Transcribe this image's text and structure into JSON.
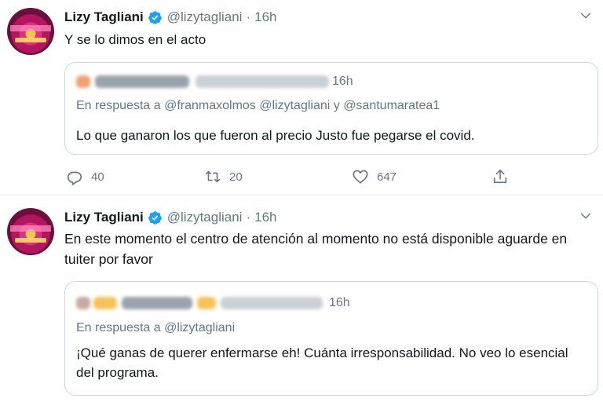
{
  "tweets": [
    {
      "author_name": "Lizy Tagliani",
      "handle": "@lizytagliani",
      "separator": "·",
      "time": "16h",
      "text": "Y se lo dimos en el acto",
      "quote": {
        "time": "16h",
        "reply_prefix": "En respuesta a",
        "reply_mentions": "@franmaxolmos @lizytagliani y @santumaratea1",
        "text": "Lo que ganaron los que fueron al precio Justo fue pegarse el covid."
      },
      "actions": {
        "replies": "40",
        "retweets": "20",
        "likes": "647"
      }
    },
    {
      "author_name": "Lizy Tagliani",
      "handle": "@lizytagliani",
      "separator": "·",
      "time": "16h",
      "text": "En este momento el centro de atención al momento no está disponible aguarde en tuiter por favor",
      "quote": {
        "time": "16h",
        "reply_prefix": "En respuesta a",
        "reply_mentions": "@lizytagliani",
        "text": "¡Qué ganas de querer enfermarse eh! Cuánta irresponsabilidad. No veo lo esencial del programa."
      }
    }
  ],
  "icons": {
    "verified": "verified-badge-icon",
    "caret": "chevron-down-icon",
    "reply": "reply-icon",
    "retweet": "retweet-icon",
    "like": "heart-icon",
    "share": "share-icon"
  },
  "colors": {
    "link_blue": "#1da1f2",
    "muted_gray": "#657786",
    "border": "#ccd6dd"
  }
}
